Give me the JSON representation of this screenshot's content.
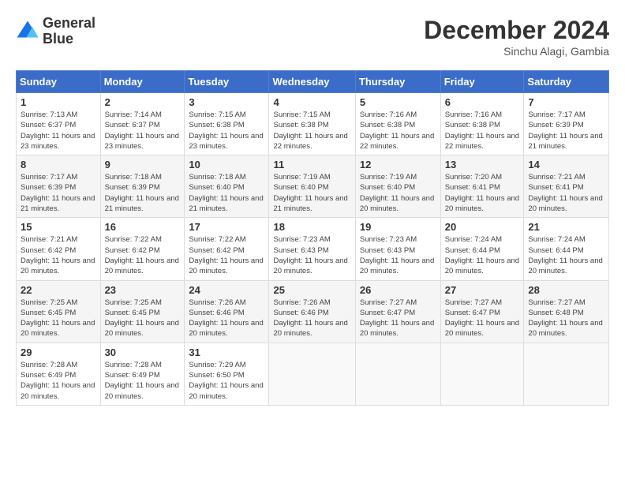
{
  "header": {
    "logo_line1": "General",
    "logo_line2": "Blue",
    "month_year": "December 2024",
    "location": "Sinchu Alagi, Gambia"
  },
  "days_of_week": [
    "Sunday",
    "Monday",
    "Tuesday",
    "Wednesday",
    "Thursday",
    "Friday",
    "Saturday"
  ],
  "weeks": [
    [
      {
        "day": "1",
        "sunrise": "7:13 AM",
        "sunset": "6:37 PM",
        "daylight": "11 hours and 23 minutes."
      },
      {
        "day": "2",
        "sunrise": "7:14 AM",
        "sunset": "6:37 PM",
        "daylight": "11 hours and 23 minutes."
      },
      {
        "day": "3",
        "sunrise": "7:15 AM",
        "sunset": "6:38 PM",
        "daylight": "11 hours and 23 minutes."
      },
      {
        "day": "4",
        "sunrise": "7:15 AM",
        "sunset": "6:38 PM",
        "daylight": "11 hours and 22 minutes."
      },
      {
        "day": "5",
        "sunrise": "7:16 AM",
        "sunset": "6:38 PM",
        "daylight": "11 hours and 22 minutes."
      },
      {
        "day": "6",
        "sunrise": "7:16 AM",
        "sunset": "6:38 PM",
        "daylight": "11 hours and 22 minutes."
      },
      {
        "day": "7",
        "sunrise": "7:17 AM",
        "sunset": "6:39 PM",
        "daylight": "11 hours and 21 minutes."
      }
    ],
    [
      {
        "day": "8",
        "sunrise": "7:17 AM",
        "sunset": "6:39 PM",
        "daylight": "11 hours and 21 minutes."
      },
      {
        "day": "9",
        "sunrise": "7:18 AM",
        "sunset": "6:39 PM",
        "daylight": "11 hours and 21 minutes."
      },
      {
        "day": "10",
        "sunrise": "7:18 AM",
        "sunset": "6:40 PM",
        "daylight": "11 hours and 21 minutes."
      },
      {
        "day": "11",
        "sunrise": "7:19 AM",
        "sunset": "6:40 PM",
        "daylight": "11 hours and 21 minutes."
      },
      {
        "day": "12",
        "sunrise": "7:19 AM",
        "sunset": "6:40 PM",
        "daylight": "11 hours and 20 minutes."
      },
      {
        "day": "13",
        "sunrise": "7:20 AM",
        "sunset": "6:41 PM",
        "daylight": "11 hours and 20 minutes."
      },
      {
        "day": "14",
        "sunrise": "7:21 AM",
        "sunset": "6:41 PM",
        "daylight": "11 hours and 20 minutes."
      }
    ],
    [
      {
        "day": "15",
        "sunrise": "7:21 AM",
        "sunset": "6:42 PM",
        "daylight": "11 hours and 20 minutes."
      },
      {
        "day": "16",
        "sunrise": "7:22 AM",
        "sunset": "6:42 PM",
        "daylight": "11 hours and 20 minutes."
      },
      {
        "day": "17",
        "sunrise": "7:22 AM",
        "sunset": "6:42 PM",
        "daylight": "11 hours and 20 minutes."
      },
      {
        "day": "18",
        "sunrise": "7:23 AM",
        "sunset": "6:43 PM",
        "daylight": "11 hours and 20 minutes."
      },
      {
        "day": "19",
        "sunrise": "7:23 AM",
        "sunset": "6:43 PM",
        "daylight": "11 hours and 20 minutes."
      },
      {
        "day": "20",
        "sunrise": "7:24 AM",
        "sunset": "6:44 PM",
        "daylight": "11 hours and 20 minutes."
      },
      {
        "day": "21",
        "sunrise": "7:24 AM",
        "sunset": "6:44 PM",
        "daylight": "11 hours and 20 minutes."
      }
    ],
    [
      {
        "day": "22",
        "sunrise": "7:25 AM",
        "sunset": "6:45 PM",
        "daylight": "11 hours and 20 minutes."
      },
      {
        "day": "23",
        "sunrise": "7:25 AM",
        "sunset": "6:45 PM",
        "daylight": "11 hours and 20 minutes."
      },
      {
        "day": "24",
        "sunrise": "7:26 AM",
        "sunset": "6:46 PM",
        "daylight": "11 hours and 20 minutes."
      },
      {
        "day": "25",
        "sunrise": "7:26 AM",
        "sunset": "6:46 PM",
        "daylight": "11 hours and 20 minutes."
      },
      {
        "day": "26",
        "sunrise": "7:27 AM",
        "sunset": "6:47 PM",
        "daylight": "11 hours and 20 minutes."
      },
      {
        "day": "27",
        "sunrise": "7:27 AM",
        "sunset": "6:47 PM",
        "daylight": "11 hours and 20 minutes."
      },
      {
        "day": "28",
        "sunrise": "7:27 AM",
        "sunset": "6:48 PM",
        "daylight": "11 hours and 20 minutes."
      }
    ],
    [
      {
        "day": "29",
        "sunrise": "7:28 AM",
        "sunset": "6:49 PM",
        "daylight": "11 hours and 20 minutes."
      },
      {
        "day": "30",
        "sunrise": "7:28 AM",
        "sunset": "6:49 PM",
        "daylight": "11 hours and 20 minutes."
      },
      {
        "day": "31",
        "sunrise": "7:29 AM",
        "sunset": "6:50 PM",
        "daylight": "11 hours and 20 minutes."
      },
      null,
      null,
      null,
      null
    ]
  ]
}
